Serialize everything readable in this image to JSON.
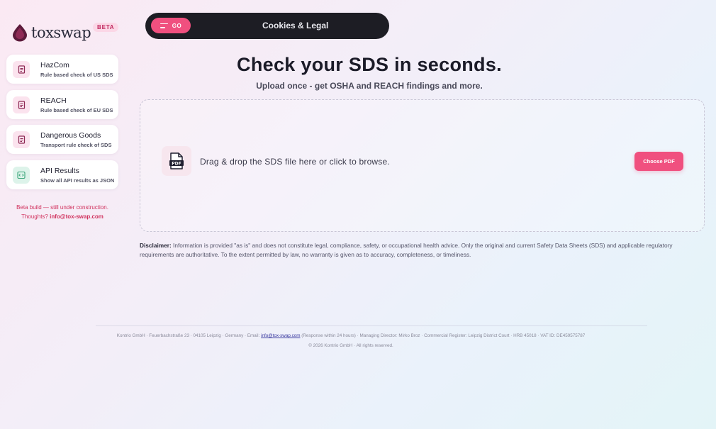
{
  "brand": {
    "name": "toxswap",
    "badge": "BETA"
  },
  "sidebar": {
    "items": [
      {
        "title": "HazCom",
        "subtitle": "Rule based check of US SDS",
        "icon": "document-icon"
      },
      {
        "title": "REACH",
        "subtitle": "Rule based check of EU SDS",
        "icon": "document-icon"
      },
      {
        "title": "Dangerous Goods",
        "subtitle": "Transport rule check of SDS",
        "icon": "document-icon"
      },
      {
        "title": "API Results",
        "subtitle": "Show all API results as JSON",
        "icon": "code-icon"
      }
    ],
    "beta_note": "Beta build — still under construction.",
    "thoughts_label": "Thoughts?",
    "contact_email": "info@tox-swap.com"
  },
  "topbar": {
    "menu_label": "GO",
    "link_label": "Cookies & Legal"
  },
  "hero": {
    "title": "Check your SDS in seconds.",
    "subtitle": "Upload once - get OSHA and REACH findings and more."
  },
  "dropzone": {
    "text": "Drag & drop the SDS file here or click to browse.",
    "button_label": "Choose PDF",
    "icon": "pdf-icon"
  },
  "disclaimer": {
    "label": "Disclaimer:",
    "text": "Information is provided \"as is\" and does not constitute legal, compliance, safety, or occupational health advice. Only the original and current Safety Data Sheets (SDS) and applicable regulatory requirements are authoritative. To the extent permitted by law, no warranty is given as to accuracy, completeness, or timeliness."
  },
  "footer": {
    "company_prefix": "Kontrio GmbH · Feuerbachstraße 23 · 04105 Leipzig · Germany · Email: ",
    "email": "info@tox-swap.com",
    "company_suffix": " (Response within 24 hours) · Managing Director: Mirko Broz · Commercial Register: Leipzig District Court · HRB 45018 · VAT ID: DE459575787",
    "copyright": "© 2026 Kontrio GmbH · All rights reserved."
  },
  "colors": {
    "accent": "#f0507f",
    "topbar_bg": "#1d1d24",
    "api_icon": "#3aa57a"
  }
}
